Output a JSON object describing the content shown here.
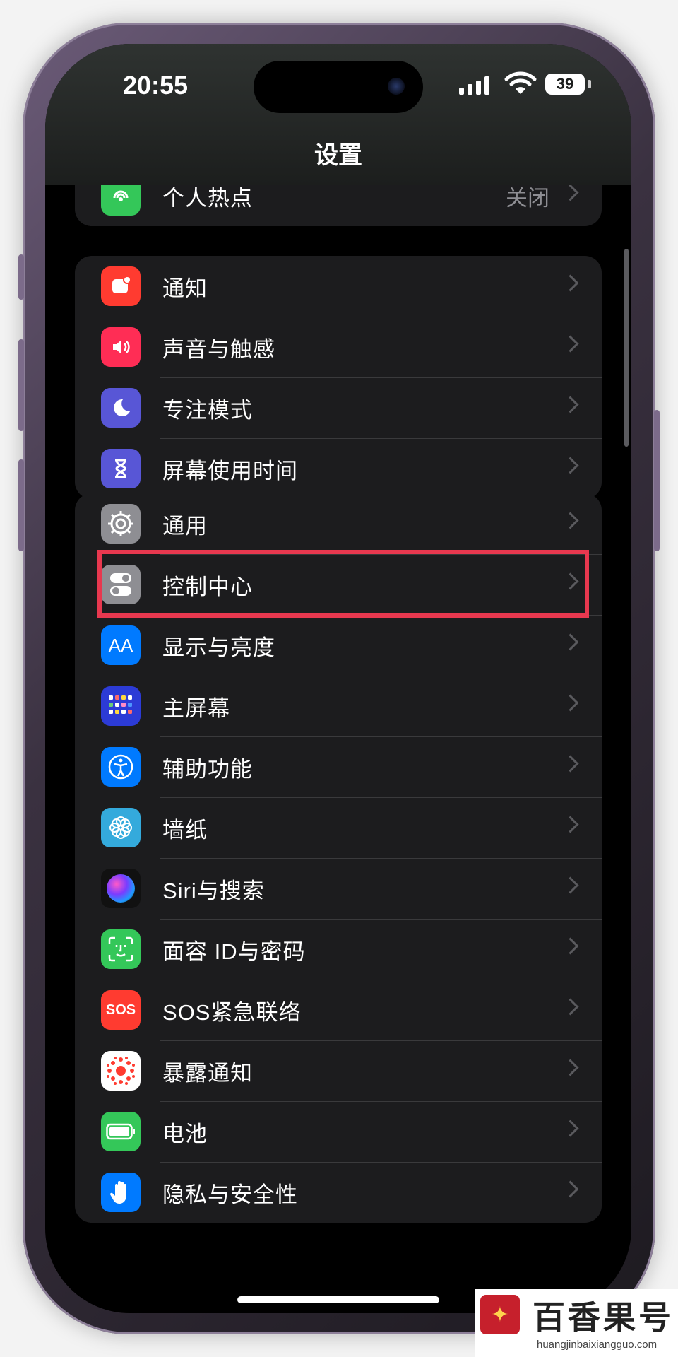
{
  "status_bar": {
    "time": "20:55",
    "battery_level": "39"
  },
  "nav": {
    "title": "设置"
  },
  "groups": [
    {
      "items": [
        {
          "label": "个人热点",
          "value": "关闭",
          "icon": "hotspot-icon",
          "icon_color": "#34c759"
        }
      ]
    },
    {
      "items": [
        {
          "label": "通知",
          "icon": "notification-icon",
          "icon_color": "#ff3b30"
        },
        {
          "label": "声音与触感",
          "icon": "sound-icon",
          "icon_color": "#ff2d55"
        },
        {
          "label": "专注模式",
          "icon": "moon-icon",
          "icon_color": "#5856d6"
        },
        {
          "label": "屏幕使用时间",
          "icon": "hourglass-icon",
          "icon_color": "#5856d6"
        }
      ]
    },
    {
      "items": [
        {
          "label": "通用",
          "icon": "gear-icon",
          "icon_color": "#8e8e93"
        },
        {
          "label": "控制中心",
          "icon": "toggle-icon",
          "icon_color": "#8e8e93"
        },
        {
          "label": "显示与亮度",
          "icon": "text-size-icon",
          "icon_color": "#007aff",
          "icon_text": "AA"
        },
        {
          "label": "主屏幕",
          "icon": "home-grid-icon",
          "icon_color": "#2c3bd6"
        },
        {
          "label": "辅助功能",
          "icon": "accessibility-icon",
          "icon_color": "#007aff"
        },
        {
          "label": "墙纸",
          "icon": "flower-icon",
          "icon_color": "#34aadc"
        },
        {
          "label": "Siri与搜索",
          "icon": "siri-icon",
          "icon_color": "#222222"
        },
        {
          "label": "面容 ID与密码",
          "icon": "face-id-icon",
          "icon_color": "#34c759"
        },
        {
          "label": "SOS紧急联络",
          "icon": "sos-icon",
          "icon_color": "#ff3b30",
          "icon_text": "SOS"
        },
        {
          "label": "暴露通知",
          "icon": "exposure-icon",
          "icon_color": "#ffffff"
        },
        {
          "label": "电池",
          "icon": "battery-icon",
          "icon_color": "#34c759"
        },
        {
          "label": "隐私与安全性",
          "icon": "hand-icon",
          "icon_color": "#007aff"
        }
      ]
    }
  ],
  "watermark": {
    "brand": "百香果号",
    "url": "huangjinbaixiangguo.com"
  }
}
